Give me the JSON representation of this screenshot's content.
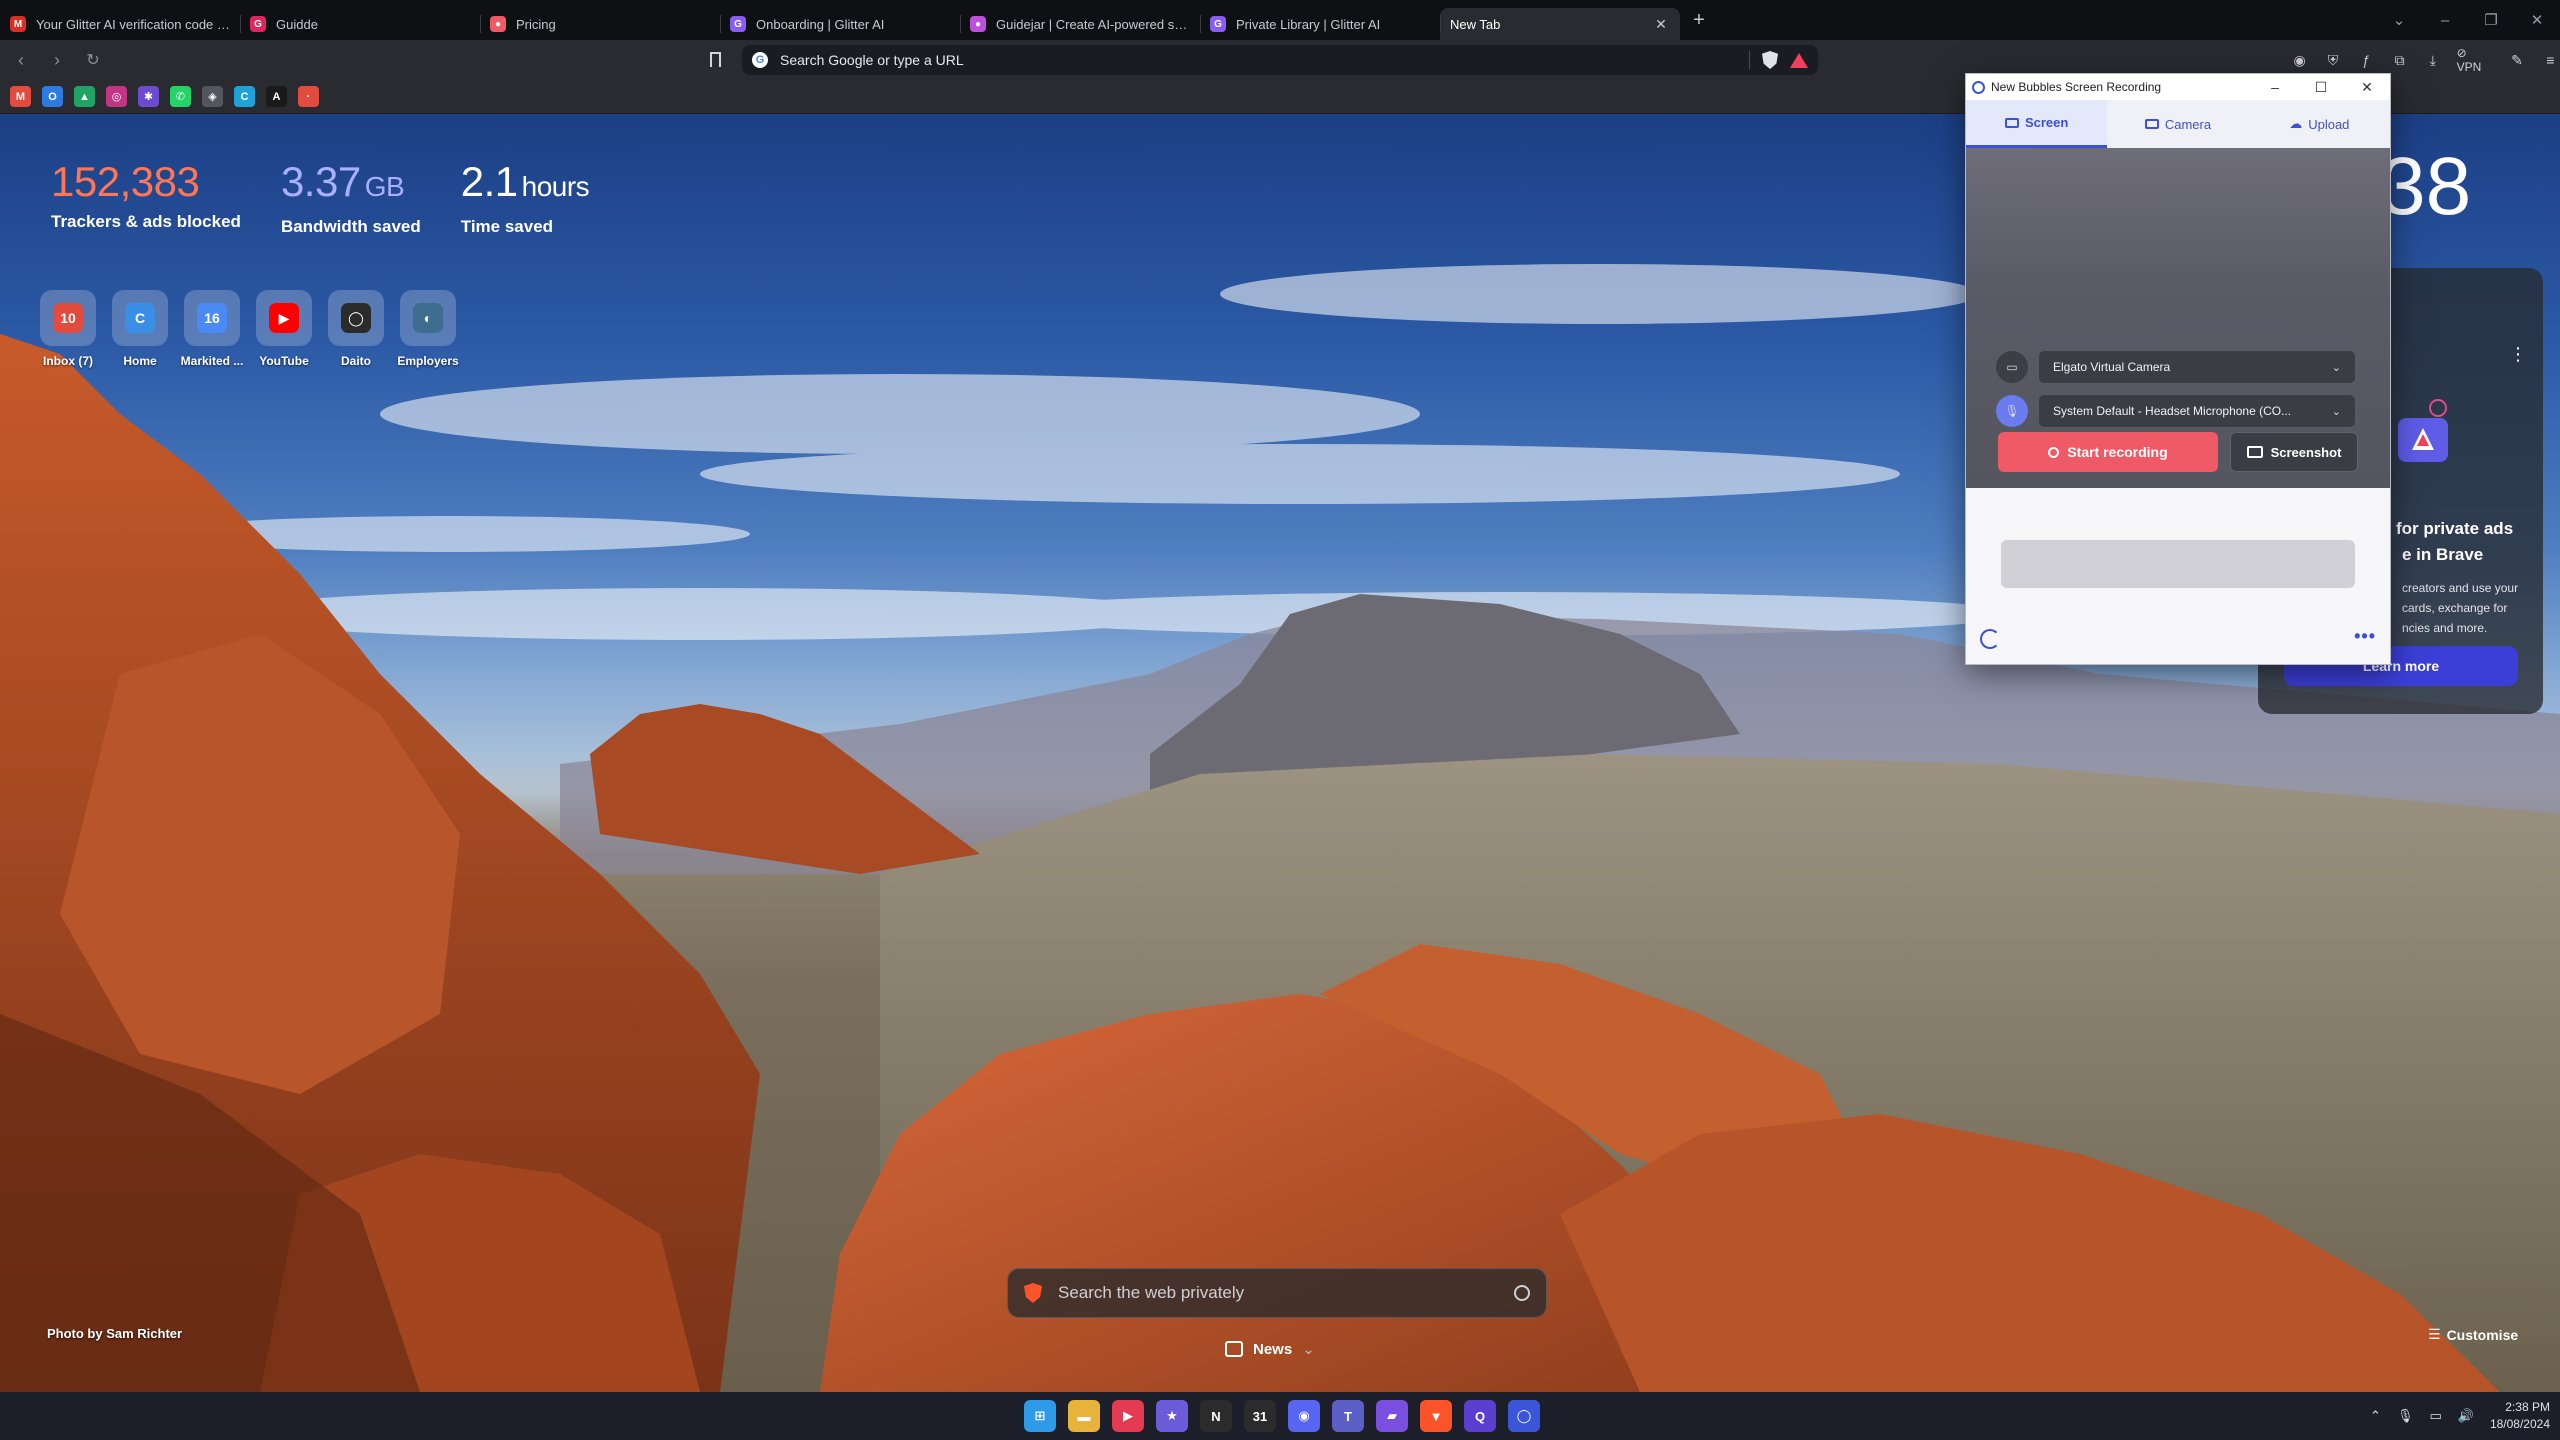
{
  "tabs": [
    {
      "title": "Your Glitter AI verification code - p",
      "icon": "gmail-icon",
      "color": "#d93025",
      "glyph": "M"
    },
    {
      "title": "Guidde",
      "icon": "guidde-icon",
      "color": "#e0245e",
      "glyph": "G"
    },
    {
      "title": "Pricing",
      "icon": "pricing-icon",
      "color": "#ef5a66",
      "glyph": "●"
    },
    {
      "title": "Onboarding | Glitter AI",
      "icon": "glitter-icon",
      "color": "#8a5cf6",
      "glyph": "G"
    },
    {
      "title": "Guidejar | Create AI-powered step-",
      "icon": "guidejar-icon",
      "color": "#c04fe0",
      "glyph": "●"
    },
    {
      "title": "Private Library | Glitter AI",
      "icon": "glitter-icon",
      "color": "#8a5cf6",
      "glyph": "G"
    },
    {
      "title": "New Tab",
      "icon": "",
      "color": "",
      "glyph": ""
    }
  ],
  "omnibox": {
    "placeholder": "Search Google or type a URL"
  },
  "toolbar_right": {
    "vpn": "VPN"
  },
  "bookmarks": [
    {
      "icon": "gmail-icon",
      "color": "#e14c3e",
      "glyph": "M"
    },
    {
      "icon": "outlook-icon",
      "color": "#2d7be0",
      "glyph": "O"
    },
    {
      "icon": "drive-icon",
      "color": "#1fa463",
      "glyph": "▲"
    },
    {
      "icon": "instagram-icon",
      "color": "#c13584",
      "glyph": "◎"
    },
    {
      "icon": "app-icon",
      "color": "#6d4bd1",
      "glyph": "✱"
    },
    {
      "icon": "whatsapp-icon",
      "color": "#25d366",
      "glyph": "✆"
    },
    {
      "icon": "chatgpt-icon",
      "color": "#555560",
      "glyph": "◈"
    },
    {
      "icon": "canva-icon",
      "color": "#1fa2d5",
      "glyph": "C"
    },
    {
      "icon": "anthropic-icon",
      "color": "#1a1a1a",
      "glyph": "A"
    },
    {
      "icon": "dot-icon",
      "color": "#e14c3e",
      "glyph": "·"
    }
  ],
  "stats": [
    {
      "value": "152,383",
      "unit": "",
      "label": "Trackers & ads blocked"
    },
    {
      "value": "3.37",
      "unit": "GB",
      "label": "Bandwidth saved"
    },
    {
      "value": "2.1",
      "unit": "hours",
      "label": "Time saved"
    }
  ],
  "top_sites": [
    {
      "name": "Inbox (7)",
      "icon": "gmail-icon",
      "color": "#e14c3e",
      "glyph": "10"
    },
    {
      "name": "Home",
      "icon": "canva-icon",
      "color": "#3a8ee6",
      "glyph": "C"
    },
    {
      "name": "Markited ...",
      "icon": "calendar-icon",
      "color": "#4a8af4",
      "glyph": "16"
    },
    {
      "name": "YouTube",
      "icon": "youtube-icon",
      "color": "#ff0000",
      "glyph": "▶"
    },
    {
      "name": "Daito",
      "icon": "daito-icon",
      "color": "#2b2b2b",
      "glyph": "◯"
    },
    {
      "name": "Employers",
      "icon": "globe-icon",
      "color": "#3e6d8f",
      "glyph": "◐"
    }
  ],
  "clock_partial": "38",
  "rewards": {
    "heading_line1": "for private ads",
    "heading_line2": "e in Brave",
    "body_line1": "creators and use your",
    "body_line2": "cards, exchange for",
    "body_line3": "ncies and more.",
    "button": "Learn more"
  },
  "bubbles": {
    "title": "New Bubbles Screen Recording",
    "tabs": [
      "Screen",
      "Camera",
      "Upload"
    ],
    "camera": "Elgato Virtual Camera",
    "microphone": "System Default - Headset Microphone (CO...",
    "start": "Start recording",
    "screenshot": "Screenshot"
  },
  "photo_credit": "Photo by Sam Richter",
  "search": {
    "placeholder": "Search the web privately"
  },
  "news": "News",
  "customise": "Customise",
  "taskbar_icons": [
    {
      "icon": "windows-start-icon",
      "color": "#2f9be8",
      "glyph": "⊞"
    },
    {
      "icon": "file-explorer-icon",
      "color": "#e8b33a",
      "glyph": "▬"
    },
    {
      "icon": "cast-icon",
      "color": "#e23b52",
      "glyph": "▶"
    },
    {
      "icon": "app-star-icon",
      "color": "#6a5bd8",
      "glyph": "★"
    },
    {
      "icon": "notion-icon",
      "color": "#2b2b2b",
      "glyph": "N"
    },
    {
      "icon": "calendar-app-icon",
      "color": "#2b2b2b",
      "glyph": "31"
    },
    {
      "icon": "discord-icon",
      "color": "#5865f2",
      "glyph": "◉"
    },
    {
      "icon": "teams-icon",
      "color": "#5b5fc7",
      "glyph": "T"
    },
    {
      "icon": "clipchamp-icon",
      "color": "#7a4fe0",
      "glyph": "▰"
    },
    {
      "icon": "brave-icon",
      "color": "#fb542b",
      "glyph": "▼"
    },
    {
      "icon": "app-q-icon",
      "color": "#5a3fd0",
      "glyph": "Q"
    },
    {
      "icon": "bubbles-icon",
      "color": "#3b55d9",
      "glyph": "◯"
    }
  ],
  "tray": {
    "time": "2:38 PM",
    "date": "18/08/2024"
  }
}
